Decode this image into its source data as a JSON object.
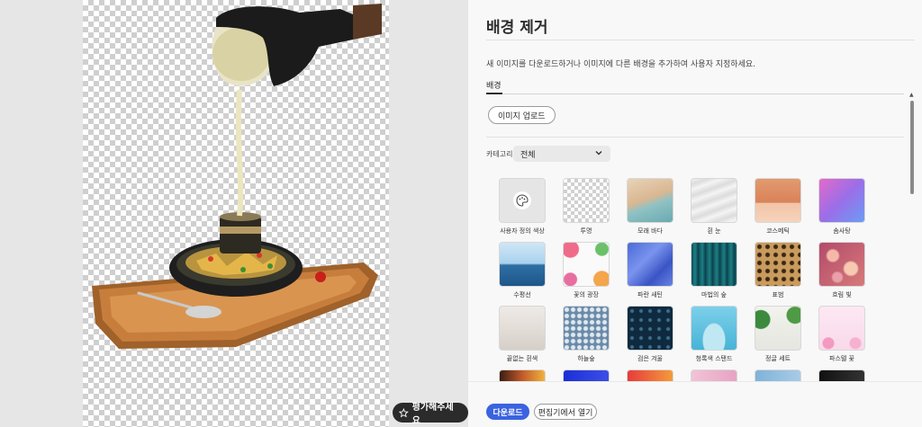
{
  "preview": {
    "rate_label": "평가해주세요"
  },
  "panel": {
    "title": "배경 제거",
    "description": "새 이미지를 다운로드하거나 이미지에 다른 배경을 추가하여 사용자 지정하세요.",
    "tab_label": "배경",
    "upload_label": "이미지 업로드",
    "category_label": "카테고리",
    "category_value": "전체"
  },
  "backgrounds": [
    {
      "label": "사용자 정의 색상",
      "icon": "palette-icon"
    },
    {
      "label": "투명"
    },
    {
      "label": "모래 바다"
    },
    {
      "label": "흰 눈"
    },
    {
      "label": "코스메틱"
    },
    {
      "label": "솜사탕"
    },
    {
      "label": "수평선"
    },
    {
      "label": "꽃의 광장"
    },
    {
      "label": "파란 새틴"
    },
    {
      "label": "마법의 숲"
    },
    {
      "label": "표범"
    },
    {
      "label": "흐림 빛"
    },
    {
      "label": "끝없는 흰색"
    },
    {
      "label": "하늘숲"
    },
    {
      "label": "검은 겨울"
    },
    {
      "label": "청록색 스탠드"
    },
    {
      "label": "정글 세트"
    },
    {
      "label": "파스텔 꽃"
    }
  ],
  "footer": {
    "download_label": "다운로드",
    "open_editor_label": "편집기에서 열기"
  },
  "colors": {
    "accent": "#3b63e0",
    "rate_button_bg": "#2b2b2b"
  }
}
